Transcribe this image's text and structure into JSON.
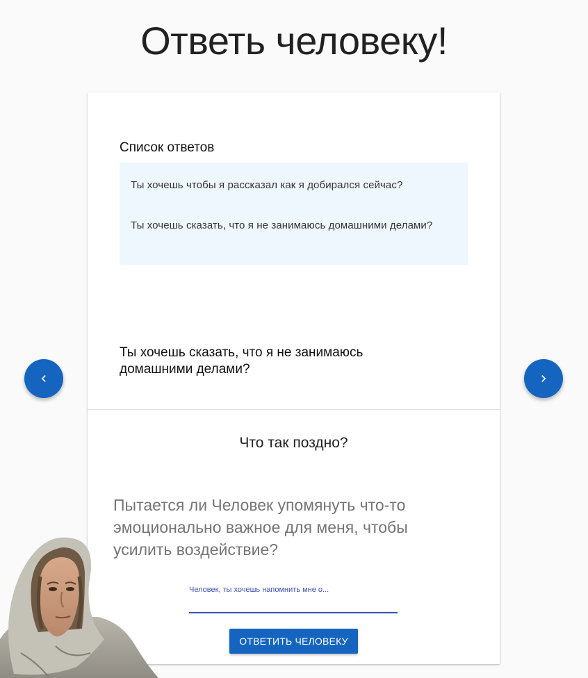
{
  "page": {
    "title": "Ответь человеку!"
  },
  "answers": {
    "title": "Список ответов",
    "items": [
      "Ты хочешь чтобы я рассказал как я добирался сейчас?",
      "Ты хочешь сказать, что я не занимаюсь домашними делами?"
    ]
  },
  "current_answer": "Ты хочешь сказать, что я не занимаюсь домашними делами?",
  "question": "Что так поздно?",
  "hint": "Пытается ли Человек упомянуть что-то эмоционально важное для меня, чтобы усилить воздействие?",
  "reply_input": {
    "label": "Человек, ты хочешь напомнить мне о...",
    "value": ""
  },
  "submit_label": "ОТВЕТИТЬ ЧЕЛОВЕКУ",
  "nav": {
    "prev_icon": "chevron-left-icon",
    "next_icon": "chevron-right-icon"
  },
  "colors": {
    "primary": "#1565c0",
    "input_accent": "#3f51b5",
    "answers_bg": "#eef6fe",
    "page_bg": "#fafafa"
  }
}
